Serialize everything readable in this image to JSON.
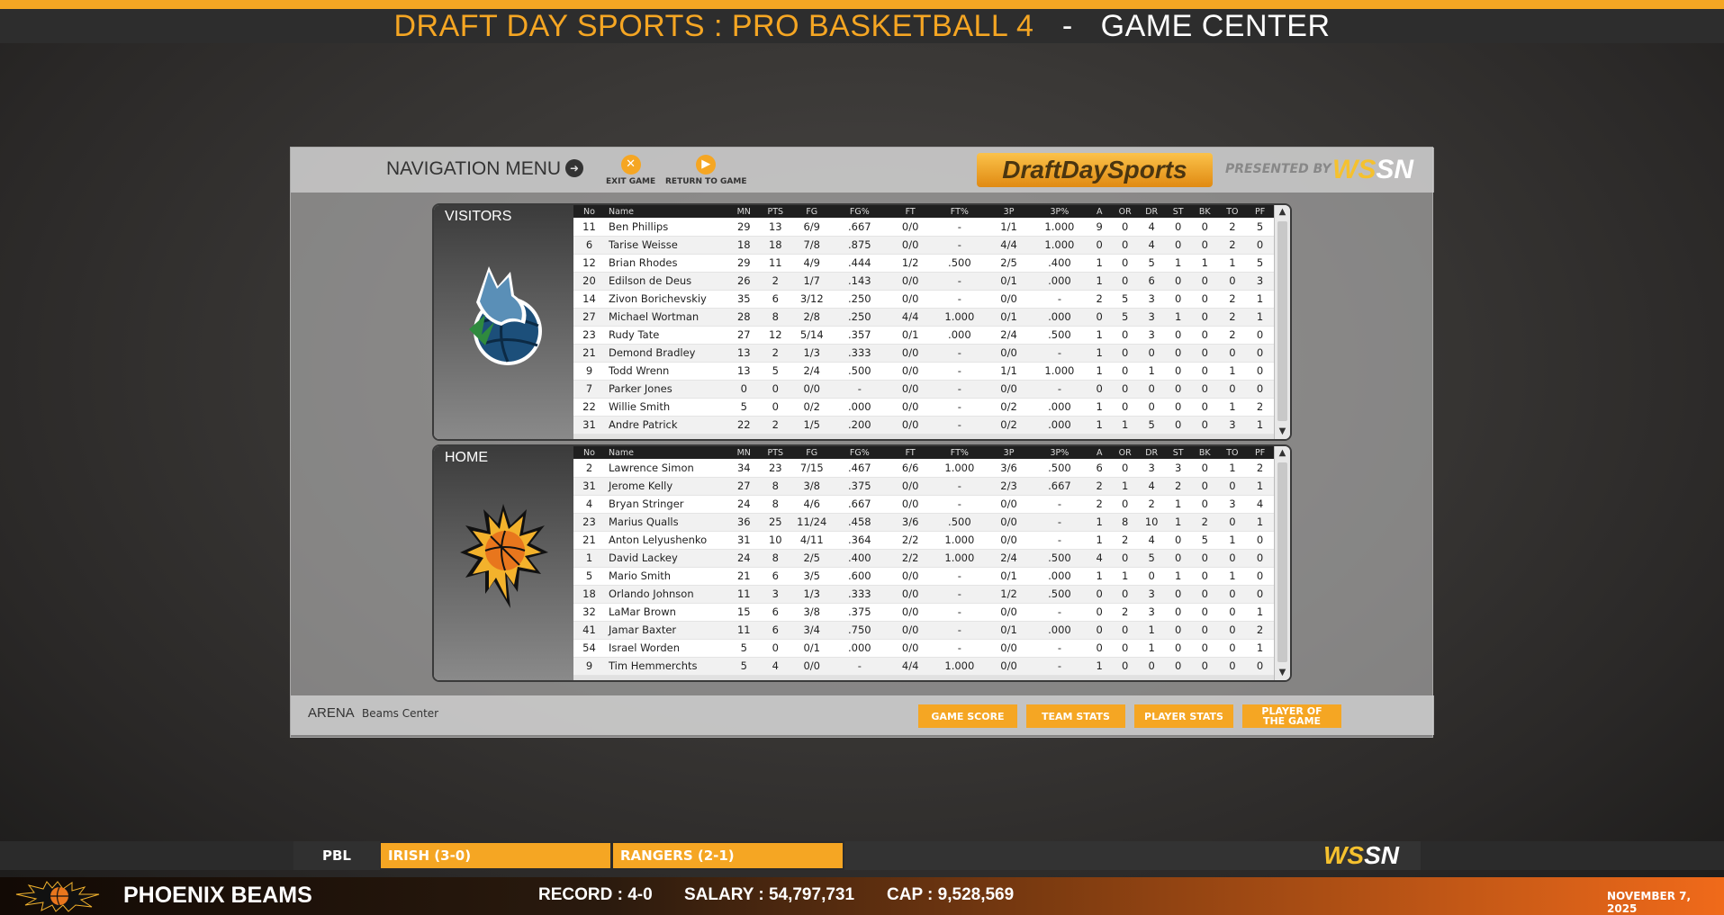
{
  "header": {
    "title_left": "DRAFT DAY SPORTS : PRO BASKETBALL 4",
    "separator": "-",
    "title_right": "GAME CENTER"
  },
  "nav": {
    "label": "NAVIGATION MENU",
    "exit_label": "EXIT GAME",
    "return_label": "RETURN TO GAME",
    "logo_text": "DraftDaySports",
    "presented_by": "PRESENTED BY",
    "wssn_ws": "WS",
    "wssn_sn": "SN"
  },
  "columns": [
    "No",
    "Name",
    "MN",
    "PTS",
    "FG",
    "FG%",
    "FT",
    "FT%",
    "3P",
    "3P%",
    "A",
    "OR",
    "DR",
    "ST",
    "BK",
    "TO",
    "PF"
  ],
  "visitors": {
    "label": "VISITORS",
    "rows": [
      [
        "11",
        "Ben Phillips",
        "29",
        "13",
        "6/9",
        ".667",
        "0/0",
        "-",
        "1/1",
        "1.000",
        "9",
        "0",
        "4",
        "0",
        "0",
        "2",
        "5"
      ],
      [
        "6",
        "Tarise Weisse",
        "18",
        "18",
        "7/8",
        ".875",
        "0/0",
        "-",
        "4/4",
        "1.000",
        "0",
        "0",
        "4",
        "0",
        "0",
        "2",
        "0"
      ],
      [
        "12",
        "Brian Rhodes",
        "29",
        "11",
        "4/9",
        ".444",
        "1/2",
        ".500",
        "2/5",
        ".400",
        "1",
        "0",
        "5",
        "1",
        "1",
        "1",
        "5"
      ],
      [
        "20",
        "Edilson de Deus",
        "26",
        "2",
        "1/7",
        ".143",
        "0/0",
        "-",
        "0/1",
        ".000",
        "1",
        "0",
        "6",
        "0",
        "0",
        "0",
        "3"
      ],
      [
        "14",
        "Zivon Borichevskiy",
        "35",
        "6",
        "3/12",
        ".250",
        "0/0",
        "-",
        "0/0",
        "-",
        "2",
        "5",
        "3",
        "0",
        "0",
        "2",
        "1"
      ],
      [
        "27",
        "Michael Wortman",
        "28",
        "8",
        "2/8",
        ".250",
        "4/4",
        "1.000",
        "0/1",
        ".000",
        "0",
        "5",
        "3",
        "1",
        "0",
        "2",
        "1"
      ],
      [
        "23",
        "Rudy Tate",
        "27",
        "12",
        "5/14",
        ".357",
        "0/1",
        ".000",
        "2/4",
        ".500",
        "1",
        "0",
        "3",
        "0",
        "0",
        "2",
        "0"
      ],
      [
        "21",
        "Demond Bradley",
        "13",
        "2",
        "1/3",
        ".333",
        "0/0",
        "-",
        "0/0",
        "-",
        "1",
        "0",
        "0",
        "0",
        "0",
        "0",
        "0"
      ],
      [
        "9",
        "Todd Wrenn",
        "13",
        "5",
        "2/4",
        ".500",
        "0/0",
        "-",
        "1/1",
        "1.000",
        "1",
        "0",
        "1",
        "0",
        "0",
        "1",
        "0"
      ],
      [
        "7",
        "Parker Jones",
        "0",
        "0",
        "0/0",
        "-",
        "0/0",
        "-",
        "0/0",
        "-",
        "0",
        "0",
        "0",
        "0",
        "0",
        "0",
        "0"
      ],
      [
        "22",
        "Willie Smith",
        "5",
        "0",
        "0/2",
        ".000",
        "0/0",
        "-",
        "0/2",
        ".000",
        "1",
        "0",
        "0",
        "0",
        "0",
        "1",
        "2"
      ],
      [
        "31",
        "Andre Patrick",
        "22",
        "2",
        "1/5",
        ".200",
        "0/0",
        "-",
        "0/2",
        ".000",
        "1",
        "1",
        "5",
        "0",
        "0",
        "3",
        "1"
      ]
    ]
  },
  "home": {
    "label": "HOME",
    "rows": [
      [
        "2",
        "Lawrence Simon",
        "34",
        "23",
        "7/15",
        ".467",
        "6/6",
        "1.000",
        "3/6",
        ".500",
        "6",
        "0",
        "3",
        "3",
        "0",
        "1",
        "2"
      ],
      [
        "31",
        "Jerome Kelly",
        "27",
        "8",
        "3/8",
        ".375",
        "0/0",
        "-",
        "2/3",
        ".667",
        "2",
        "1",
        "4",
        "2",
        "0",
        "0",
        "1"
      ],
      [
        "4",
        "Bryan Stringer",
        "24",
        "8",
        "4/6",
        ".667",
        "0/0",
        "-",
        "0/0",
        "-",
        "2",
        "0",
        "2",
        "1",
        "0",
        "3",
        "4"
      ],
      [
        "23",
        "Marius Qualls",
        "36",
        "25",
        "11/24",
        ".458",
        "3/6",
        ".500",
        "0/0",
        "-",
        "1",
        "8",
        "10",
        "1",
        "2",
        "0",
        "1"
      ],
      [
        "21",
        "Anton Lelyushenko",
        "31",
        "10",
        "4/11",
        ".364",
        "2/2",
        "1.000",
        "0/0",
        "-",
        "1",
        "2",
        "4",
        "0",
        "5",
        "1",
        "0"
      ],
      [
        "1",
        "David Lackey",
        "24",
        "8",
        "2/5",
        ".400",
        "2/2",
        "1.000",
        "2/4",
        ".500",
        "4",
        "0",
        "5",
        "0",
        "0",
        "0",
        "0"
      ],
      [
        "5",
        "Mario Smith",
        "21",
        "6",
        "3/5",
        ".600",
        "0/0",
        "-",
        "0/1",
        ".000",
        "1",
        "1",
        "0",
        "1",
        "0",
        "1",
        "0"
      ],
      [
        "18",
        "Orlando Johnson",
        "11",
        "3",
        "1/3",
        ".333",
        "0/0",
        "-",
        "1/2",
        ".500",
        "0",
        "0",
        "3",
        "0",
        "0",
        "0",
        "0"
      ],
      [
        "32",
        "LaMar Brown",
        "15",
        "6",
        "3/8",
        ".375",
        "0/0",
        "-",
        "0/0",
        "-",
        "0",
        "2",
        "3",
        "0",
        "0",
        "0",
        "1"
      ],
      [
        "41",
        "Jamar Baxter",
        "11",
        "6",
        "3/4",
        ".750",
        "0/0",
        "-",
        "0/1",
        ".000",
        "0",
        "0",
        "1",
        "0",
        "0",
        "0",
        "2"
      ],
      [
        "54",
        "Israel Worden",
        "5",
        "0",
        "0/1",
        ".000",
        "0/0",
        "-",
        "0/0",
        "-",
        "0",
        "0",
        "1",
        "0",
        "0",
        "0",
        "1"
      ],
      [
        "9",
        "Tim Hemmerchts",
        "5",
        "4",
        "0/0",
        "-",
        "4/4",
        "1.000",
        "0/0",
        "-",
        "1",
        "0",
        "0",
        "0",
        "0",
        "0",
        "0"
      ]
    ]
  },
  "arena": {
    "label": "ARENA",
    "value": "Beams Center"
  },
  "buttons": {
    "game_score": "GAME SCORE",
    "team_stats": "TEAM STATS",
    "player_stats": "PLAYER STATS",
    "player_of_game_1": "PLAYER OF",
    "player_of_game_2": "THE GAME"
  },
  "ticker": {
    "league": "PBL",
    "game1": "IRISH (3-0)",
    "game2": "RANGERS (2-1)"
  },
  "footer": {
    "team_name": "PHOENIX BEAMS",
    "record": "RECORD : 4-0",
    "salary": "SALARY : 54,797,731",
    "cap": "CAP : 9,528,569",
    "date": "NOVEMBER 7, 2025"
  },
  "colors": {
    "accent": "#f5a623",
    "dark": "#2d2d2d"
  }
}
